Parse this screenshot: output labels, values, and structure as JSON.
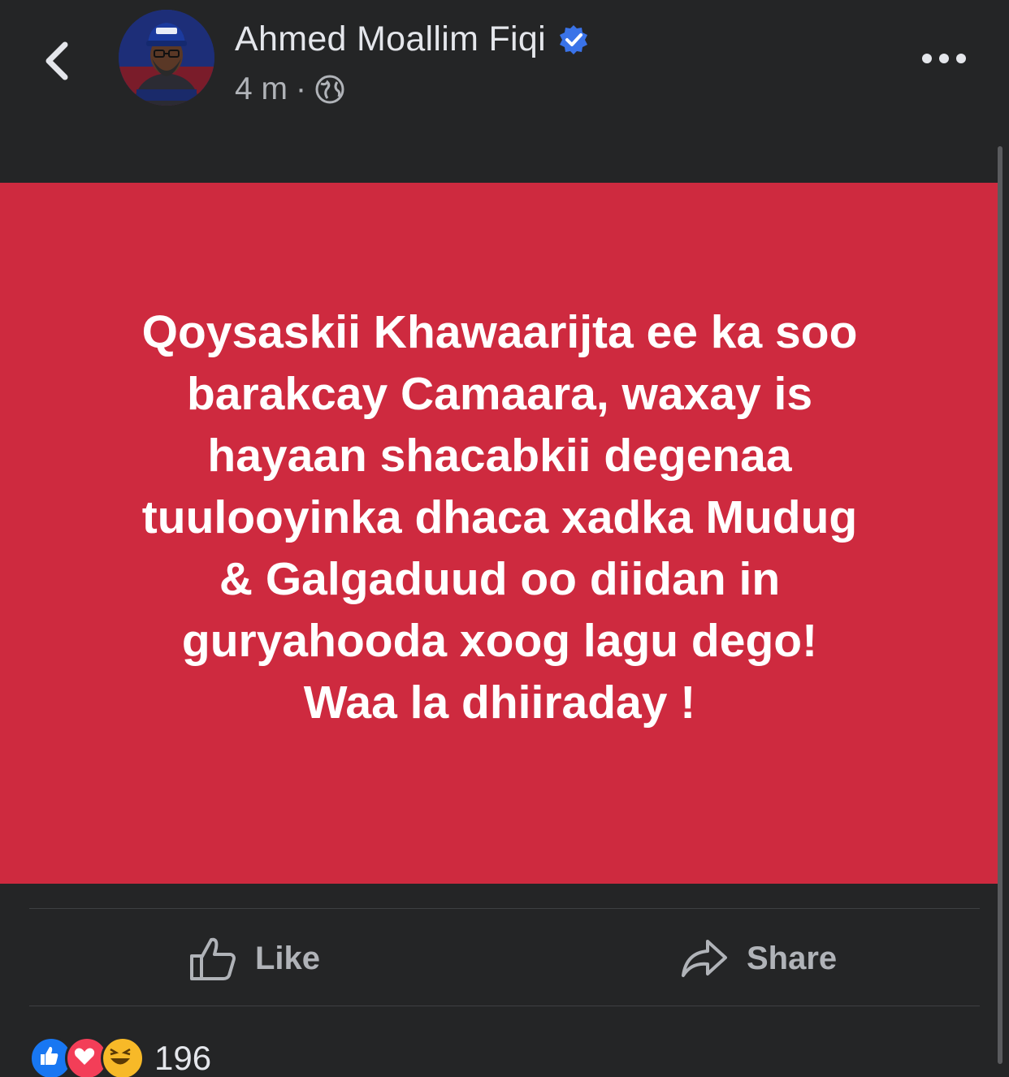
{
  "header": {
    "author_name": "Ahmed Moallim Fiqi",
    "time": "4 m",
    "separator": "·",
    "verified_icon": "verified-badge-icon",
    "privacy_icon": "globe-icon"
  },
  "post": {
    "background_color": "#ce2a3f",
    "lines": [
      "Qoysaskii Khawaarijta ee ka soo",
      "barakcay Camaara, waxay is",
      "hayaan shacabkii degenaa",
      "tuulooyinka dhaca xadka Mudug",
      "& Galgaduud oo  diidan in",
      "guryahooda xoog lagu dego!",
      "Waa la dhiiraday !"
    ]
  },
  "actions": {
    "like_label": "Like",
    "share_label": "Share"
  },
  "reactions": {
    "count": "196",
    "types": [
      "like-reaction-icon",
      "love-reaction-icon",
      "haha-reaction-icon"
    ]
  },
  "colors": {
    "accent_blue": "#1877f2",
    "post_red": "#ce2a3f",
    "background": "#242526"
  }
}
